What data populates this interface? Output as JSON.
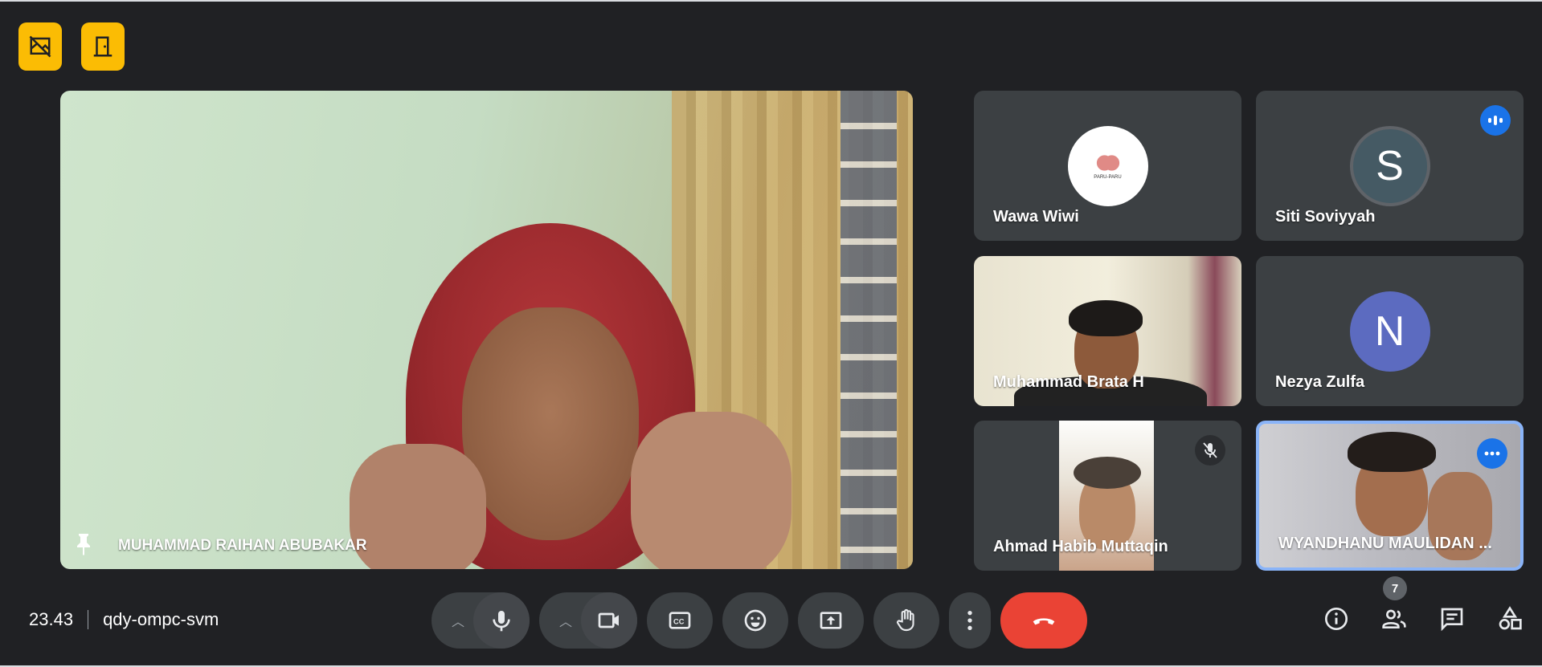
{
  "top_badges": [
    {
      "icon": "no-background-icon"
    },
    {
      "icon": "door-exit-icon"
    }
  ],
  "main": {
    "name": "MUHAMMAD RAIHAN ABUBAKAR",
    "pinned_icon": "pin-icon"
  },
  "participants": [
    {
      "name": "Wawa Wiwi",
      "avatar": "image",
      "avatar_caption": "PARU-PARU"
    },
    {
      "name": "Siti Soviyyah",
      "avatar_letter": "S",
      "speaking": true
    },
    {
      "name": "Muhammad Brata H",
      "video": true
    },
    {
      "name": "Nezya Zulfa",
      "avatar_letter": "N"
    },
    {
      "name": "Ahmad Habib Muttaqin",
      "video": true,
      "muted": true
    },
    {
      "name": "WYANDHANU MAULIDAN ...",
      "video": true,
      "active": true
    }
  ],
  "bottom": {
    "time": "23.43",
    "meeting_code": "qdy-ompc-svm",
    "people_count": "7"
  },
  "colors": {
    "background": "#202124",
    "badge": "#fbbc04",
    "leave": "#ea4335",
    "accent": "#1a73e8",
    "active_border": "#8ab4f8"
  }
}
